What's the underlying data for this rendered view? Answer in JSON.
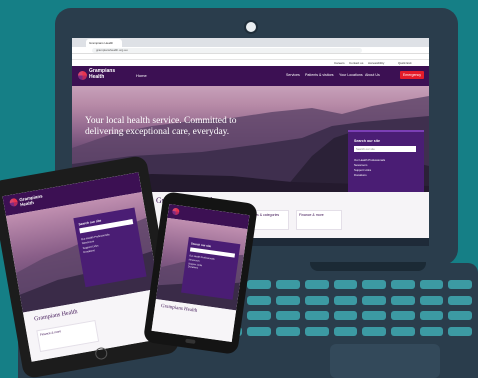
{
  "browser": {
    "tab_title": "Grampians Health",
    "url": "grampianshealth.org.au",
    "utility_links": [
      "Careers",
      "Contact us",
      "Accessibility",
      "Quick Exit"
    ]
  },
  "site": {
    "logo_line1": "Grampians",
    "logo_line2": "Health",
    "nav_home": "Home",
    "nav_items": [
      "Services",
      "Patients & visitors",
      "Your Locations",
      "About Us"
    ],
    "emergency_label": "Emergency",
    "hero_title": "Your local health service. Committed to delivering exceptional care, everyday.",
    "search_label": "Search our site",
    "search_placeholder": "Search our site",
    "quick_links": [
      "Our Health Professionals",
      "Newsroom",
      "Support Links",
      "Donations"
    ],
    "section_heading": "Grampians Health",
    "cards": [
      "News & categories",
      "Finance & more"
    ]
  },
  "colors": {
    "background": "#157f86",
    "brand_purple": "#3c1053",
    "panel_purple": "#4a1d74",
    "emergency_red": "#e51c2a"
  },
  "icons": [
    "camera-icon",
    "logo-icon",
    "search-icon",
    "chevron-down-icon"
  ]
}
